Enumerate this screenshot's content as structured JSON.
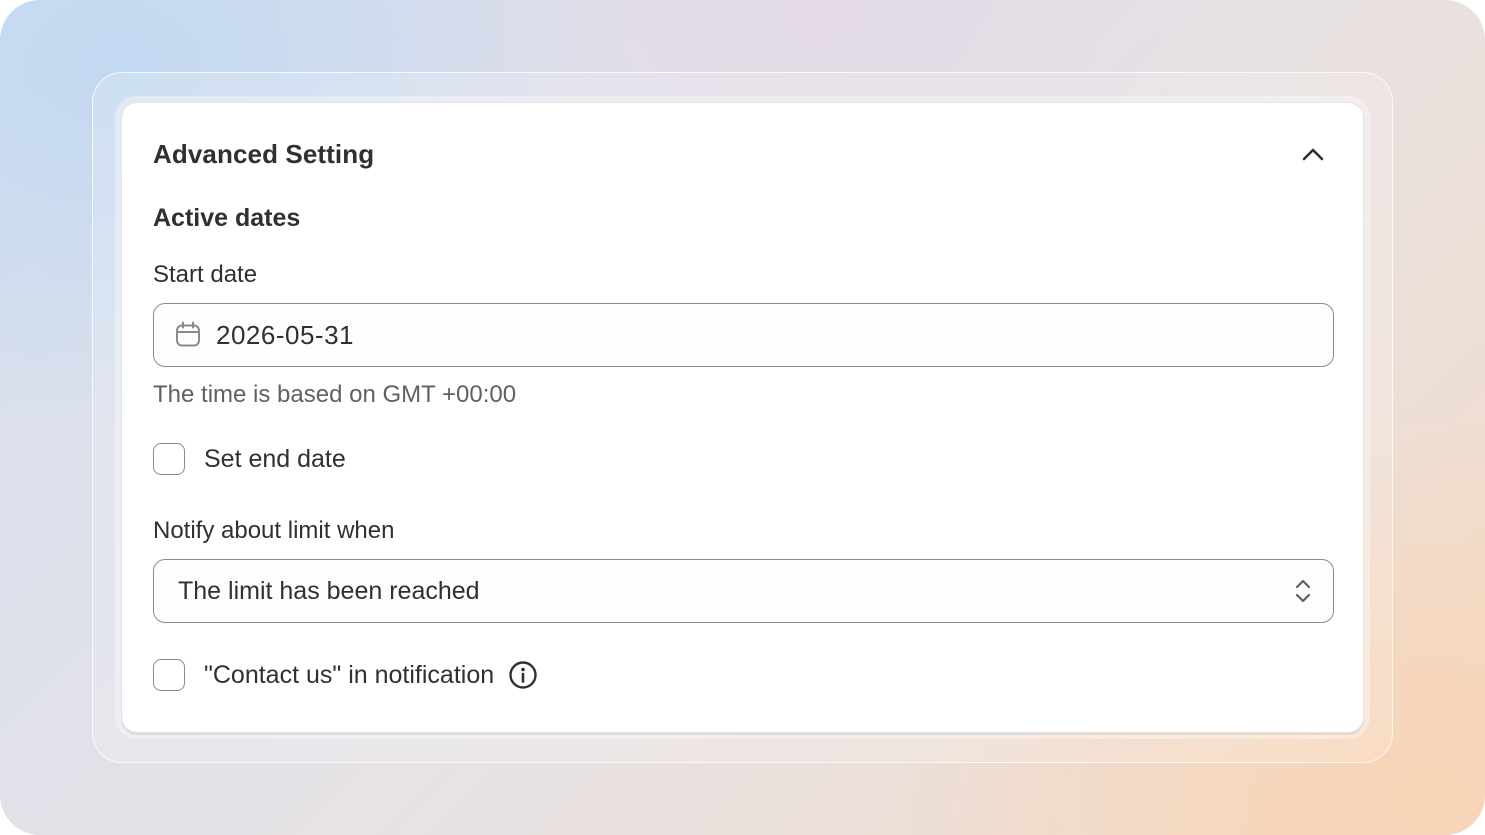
{
  "panel": {
    "title": "Advanced Setting",
    "collapse_icon": "chevron-up-icon"
  },
  "active_dates": {
    "section_title": "Active dates",
    "start_date_label": "Start date",
    "start_date_value": "2026-05-31",
    "calendar_icon": "calendar-icon",
    "timezone_help": "The time is based on GMT +00:00",
    "set_end_date_label": "Set end date",
    "set_end_date_checked": false
  },
  "notify": {
    "label": "Notify about limit when",
    "selected_option": "The limit has been reached",
    "select_icon": "select-chevrons-icon"
  },
  "contact_us": {
    "label": "\"Contact us\" in notification",
    "checked": false,
    "info_icon": "info-icon"
  },
  "colors": {
    "text_primary": "#303030",
    "text_secondary": "#616161",
    "border": "#8a8a8a",
    "card_background": "#ffffff"
  }
}
